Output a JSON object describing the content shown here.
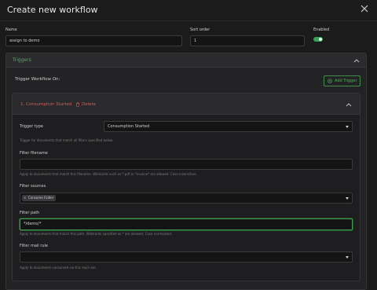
{
  "modal": {
    "title": "Create new workflow"
  },
  "fields": {
    "name_label": "Name",
    "name_value": "assign to demo",
    "sort_label": "Sort order",
    "sort_value": "1",
    "enabled_label": "Enabled",
    "enabled": true
  },
  "triggers": {
    "panel_title": "Triggers",
    "section_label": "Trigger Workflow On:",
    "add_label": "Add Trigger",
    "card": {
      "title": "1. Consumption Started",
      "delete_label": "Delete",
      "type_label": "Trigger type",
      "type_value": "Consumption Started",
      "type_hint": "Trigger for documents that match all filters specified below.",
      "filename_label": "Filter filename",
      "filename_value": "",
      "filename_hint": "Apply to documents that match this filename. Wildcards such as *.pdf or *invoice* are allowed. Case insensitive.",
      "sources_label": "Filter sources",
      "sources_chip": "Consume Folder",
      "path_label": "Filter path",
      "path_value": "*/demo/*",
      "path_hint": "Apply to documents that match this path. Wildcards specified as * are allowed. Case normalized.",
      "mailrule_label": "Filter mail rule",
      "mailrule_value": "",
      "mailrule_hint": "Apply to documents consumed via this mail rule."
    }
  },
  "colors": {
    "accent": "#4fae5c",
    "danger": "#d45a5a",
    "background": "#1b1b1c"
  }
}
